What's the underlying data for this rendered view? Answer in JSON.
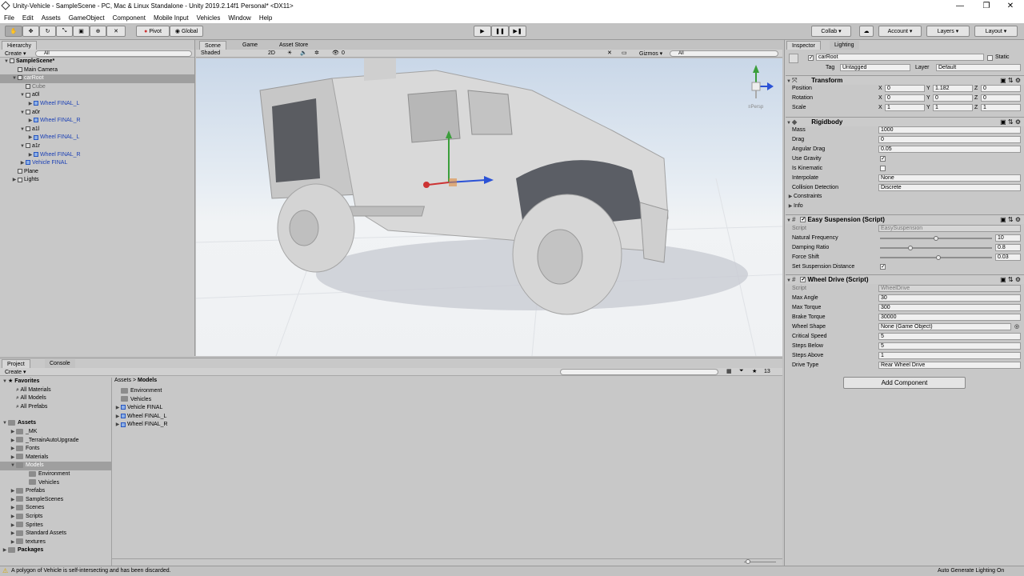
{
  "window": {
    "title": "Unity-Vehicle - SampleScene - PC, Mac & Linux Standalone - Unity 2019.2.14f1 Personal* <DX11>"
  },
  "menu": [
    "File",
    "Edit",
    "Assets",
    "GameObject",
    "Component",
    "Mobile Input",
    "Vehicles",
    "Window",
    "Help"
  ],
  "toolbar": {
    "pivot": "Pivot",
    "global": "Global",
    "collab": "Collab ▾",
    "account": "Account",
    "layers": "Layers",
    "layout": "Layout"
  },
  "hierarchy": {
    "tab": "Hierarchy",
    "create": "Create ▾",
    "search": "All",
    "items": [
      {
        "label": "SampleScene*",
        "indent": 0,
        "kind": "scene"
      },
      {
        "label": "Main Camera",
        "indent": 2,
        "kind": "plain"
      },
      {
        "label": "carRoot",
        "indent": 2,
        "kind": "sel"
      },
      {
        "label": "Cube",
        "indent": 4,
        "kind": "gray"
      },
      {
        "label": "a0l",
        "indent": 4,
        "kind": "plain"
      },
      {
        "label": "Wheel FINAL_L",
        "indent": 6,
        "kind": "blue"
      },
      {
        "label": "a0r",
        "indent": 4,
        "kind": "plain"
      },
      {
        "label": "Wheel FINAL_R",
        "indent": 6,
        "kind": "blue"
      },
      {
        "label": "a1l",
        "indent": 4,
        "kind": "plain"
      },
      {
        "label": "Wheel FINAL_L",
        "indent": 6,
        "kind": "blue"
      },
      {
        "label": "a1r",
        "indent": 4,
        "kind": "plain"
      },
      {
        "label": "Wheel FINAL_R",
        "indent": 6,
        "kind": "blue"
      },
      {
        "label": "Vehicle FINAL",
        "indent": 4,
        "kind": "blue"
      },
      {
        "label": "Plane",
        "indent": 2,
        "kind": "plain"
      },
      {
        "label": "Lights",
        "indent": 2,
        "kind": "plain"
      }
    ]
  },
  "scene": {
    "tabs": [
      "Scene",
      "Game",
      "Asset Store"
    ],
    "shaded": "Shaded",
    "mode2d": "2D",
    "gizmos": "Gizmos ▾",
    "search": "All",
    "persp": "≡Persp",
    "hidden": "0"
  },
  "inspector": {
    "tabs": [
      "Inspector",
      "Lighting"
    ],
    "object_name": "carRoot",
    "static": "Static",
    "tag_label": "Tag",
    "tag": "Untagged",
    "layer_label": "Layer",
    "layer": "Default",
    "transform": {
      "title": "Transform",
      "rows": [
        {
          "label": "Position",
          "x": "0",
          "y": "1.182",
          "z": "0"
        },
        {
          "label": "Rotation",
          "x": "0",
          "y": "0",
          "z": "0"
        },
        {
          "label": "Scale",
          "x": "1",
          "y": "1",
          "z": "1"
        }
      ]
    },
    "rigidbody": {
      "title": "Rigidbody",
      "rows": [
        {
          "label": "Mass",
          "value": "1000"
        },
        {
          "label": "Drag",
          "value": "0"
        },
        {
          "label": "Angular Drag",
          "value": "0.05"
        },
        {
          "label": "Use Gravity",
          "value": "✓",
          "check": true
        },
        {
          "label": "Is Kinematic",
          "value": "",
          "check": true
        },
        {
          "label": "Interpolate",
          "value": "None"
        },
        {
          "label": "Collision Detection",
          "value": "Discrete"
        }
      ],
      "constraints": "Constraints",
      "info": "Info"
    },
    "suspension": {
      "title": "Easy Suspension (Script)",
      "script_label": "Script",
      "script": "EasySuspension",
      "rows": [
        {
          "label": "Natural Frequency",
          "value": "10",
          "level": 0.5
        },
        {
          "label": "Damping Ratio",
          "value": "0.8",
          "level": 0.27
        },
        {
          "label": "Force Shift",
          "value": "0.03",
          "level": 0.52
        }
      ],
      "set_distance": "Set Suspension Distance"
    },
    "wheeldrive": {
      "title": "Wheel Drive (Script)",
      "script_label": "Script",
      "script": "WheelDrive",
      "rows": [
        {
          "label": "Max Angle",
          "value": "30"
        },
        {
          "label": "Max Torque",
          "value": "300"
        },
        {
          "label": "Brake Torque",
          "value": "30000"
        },
        {
          "label": "Wheel Shape",
          "value": "None (Game Object)"
        },
        {
          "label": "Critical Speed",
          "value": "5"
        },
        {
          "label": "Steps Below",
          "value": "5"
        },
        {
          "label": "Steps Above",
          "value": "1"
        },
        {
          "label": "Drive Type",
          "value": "Rear Wheel Drive"
        }
      ]
    },
    "add_component": "Add Component"
  },
  "project": {
    "tabs": [
      "Project",
      "Console"
    ],
    "create": "Create ▾",
    "favorites": {
      "title": "Favorites",
      "items": [
        "All Materials",
        "All Models",
        "All Prefabs"
      ]
    },
    "assets_title": "Assets",
    "tree": [
      {
        "label": "_MK",
        "indent": 1
      },
      {
        "label": "_TerrainAutoUpgrade",
        "indent": 1
      },
      {
        "label": "Fonts",
        "indent": 1
      },
      {
        "label": "Materials",
        "indent": 1
      },
      {
        "label": "Models",
        "indent": 1,
        "sel": true
      },
      {
        "label": "Environment",
        "indent": 2
      },
      {
        "label": "Vehicles",
        "indent": 2
      },
      {
        "label": "Prefabs",
        "indent": 1
      },
      {
        "label": "SampleScenes",
        "indent": 1
      },
      {
        "label": "Scenes",
        "indent": 1
      },
      {
        "label": "Scripts",
        "indent": 1
      },
      {
        "label": "Sprites",
        "indent": 1
      },
      {
        "label": "Standard Assets",
        "indent": 1
      },
      {
        "label": "textures",
        "indent": 1
      }
    ],
    "packages": "Packages",
    "breadcrumb": [
      "Assets",
      "Models"
    ],
    "count": "13",
    "files": [
      {
        "label": "Environment",
        "type": "folder"
      },
      {
        "label": "Vehicles",
        "type": "folder"
      },
      {
        "label": "Vehicle FINAL",
        "type": "model"
      },
      {
        "label": "Wheel FINAL_L",
        "type": "model"
      },
      {
        "label": "Wheel FINAL_R",
        "type": "model"
      }
    ]
  },
  "status": {
    "message": "A polygon of Vehicle is self-intersecting and has been discarded.",
    "right": "Auto Generate Lighting On"
  }
}
